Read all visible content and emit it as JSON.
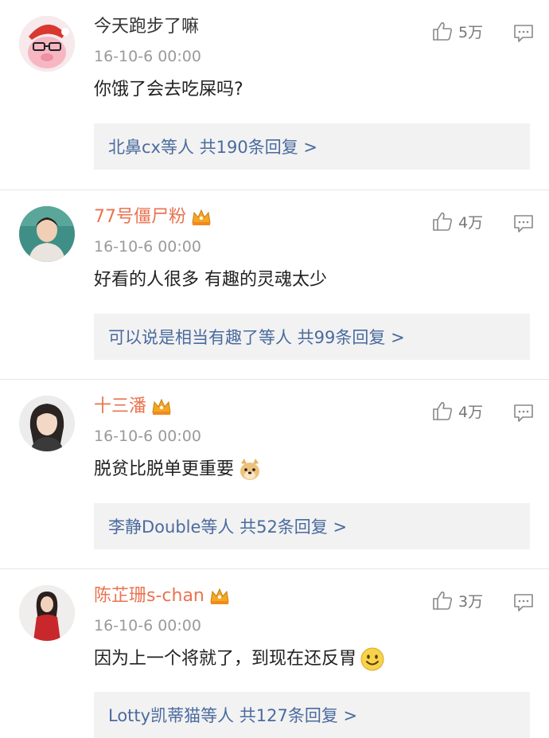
{
  "comments": [
    {
      "username": "今天跑步了嘛",
      "verified": false,
      "time": "16-10-6 00:00",
      "text": "你饿了会去吃屎吗?",
      "emoji": "",
      "likes": "5万",
      "replies": "北鼻cx等人 共190条回复 >"
    },
    {
      "username": "77号僵尸粉",
      "verified": true,
      "time": "16-10-6 00:00",
      "text": "好看的人很多 有趣的灵魂太少",
      "emoji": "",
      "likes": "4万",
      "replies": "可以说是相当有趣了等人 共99条回复 >"
    },
    {
      "username": "十三潘",
      "verified": true,
      "time": "16-10-6 00:00",
      "text": "脱贫比脱单更重要",
      "emoji": "doge-emoji",
      "likes": "4万",
      "replies": "李静Double等人 共52条回复 >"
    },
    {
      "username": "陈芷珊s-chan",
      "verified": true,
      "time": "16-10-6 00:00",
      "text": "因为上一个将就了，到现在还反胃",
      "emoji": "smile-emoji",
      "likes": "3万",
      "replies": "Lotty凯蒂猫等人 共127条回复 >"
    }
  ],
  "colors": {
    "vip_name": "#eb7350",
    "link": "#4a6b9e",
    "meta": "#9a9a9a",
    "reply_bg": "#f2f2f2"
  },
  "icons": [
    "thumbs-up-icon",
    "comment-icon",
    "vip-crown-icon"
  ]
}
